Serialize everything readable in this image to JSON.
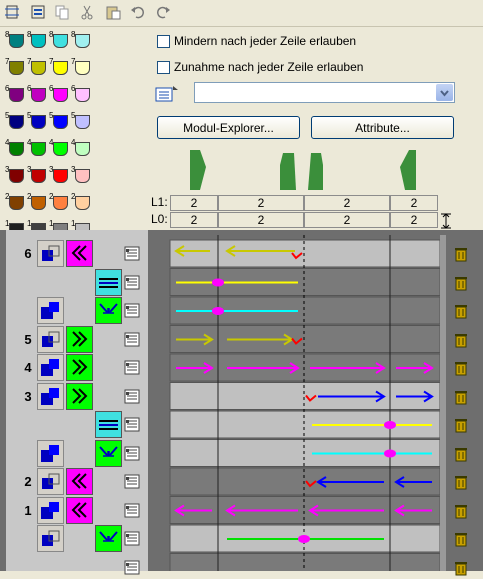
{
  "options": {
    "mindern_label": "Mindern nach jeder Zeile erlauben",
    "zunahme_label": "Zunahme nach jeder Zeile erlauben",
    "mindern_checked": false,
    "zunahme_checked": false
  },
  "buttons": {
    "modul_explorer": "Modul-Explorer...",
    "attribute": "Attribute..."
  },
  "combo": {
    "value": ""
  },
  "header": {
    "l1_label": "L1:",
    "l0_label": "L0:",
    "l1_values": [
      "2",
      "2",
      "2",
      "2"
    ],
    "l0_values": [
      "2",
      "2",
      "2",
      "2"
    ]
  },
  "swatch_numbers": [
    "8",
    "7",
    "6",
    "5",
    "4",
    "3",
    "2",
    "1"
  ],
  "row_numbers": {
    "r1": "6",
    "r6": "5",
    "r7": "4",
    "r8": "3",
    "r11": "2",
    "r12": "1"
  },
  "colors": {
    "yellow": "#c8c800",
    "bright_yellow": "#ffff00",
    "magenta": "#ff00ff",
    "cyan": "#00ffff",
    "blue": "#0000ff",
    "green": "#00e000",
    "red": "#ff0000",
    "panel": "#ece9d8",
    "grid_dark": "#6e6e6e",
    "row_light": "#c0c0c0",
    "row_dark": "#7a7a7a"
  },
  "icons": [
    "distribute-icon",
    "align-icon",
    "copy-icon",
    "cut-icon",
    "paste-icon",
    "undo-icon",
    "redo-icon",
    "module-list-icon",
    "dropdown-arrow-icon",
    "height-resize-icon",
    "trash-icon"
  ]
}
